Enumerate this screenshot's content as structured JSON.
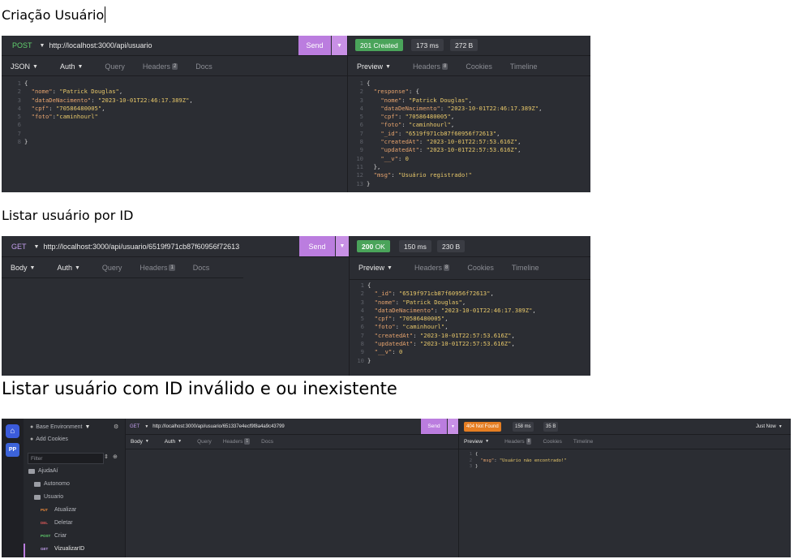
{
  "headings": {
    "create": "Criação Usuário",
    "list_by_id": "Listar usuário por ID",
    "list_invalid": "Listar usuário com ID inválido e ou inexistente"
  },
  "panel1": {
    "method": "POST",
    "url": "http://localhost:3000/api/usuario",
    "send": "Send",
    "status": "201 Created",
    "time": "173 ms",
    "size": "272 B",
    "request_tabs": [
      "JSON",
      "Auth",
      "Query",
      "Headers",
      "Docs"
    ],
    "headers_count": "2",
    "response_tabs": [
      "Preview",
      "Headers",
      "Cookies",
      "Timeline"
    ],
    "response_headers_count": "8",
    "request_body": [
      "{",
      "  \"nome\": \"Patrick Douglas\",",
      "  \"dataDeNacimento\": \"2023-10-01T22:46:17.389Z\",",
      "  \"cpf\": \"70586480005\",",
      "  \"foto\":\"caminhourl\"",
      "",
      "",
      "}"
    ],
    "response_body": [
      "{",
      "  \"response\": {",
      "    \"nome\": \"Patrick Douglas\",",
      "    \"dataDeNacimento\": \"2023-10-01T22:46:17.389Z\",",
      "    \"cpf\": \"70586480005\",",
      "    \"foto\": \"caminhourl\",",
      "    \"_id\": \"6519f971cb87f60956f72613\",",
      "    \"createdAt\": \"2023-10-01T22:57:53.616Z\",",
      "    \"updatedAt\": \"2023-10-01T22:57:53.616Z\",",
      "    \"__v\": 0",
      "  },",
      "  \"msg\": \"Usuário registrado!\"",
      "}"
    ]
  },
  "panel2": {
    "method": "GET",
    "url": "http://localhost:3000/api/usuario/6519f971cb87f60956f72613",
    "send": "Send",
    "status_code": "200",
    "status_text": "OK",
    "time": "150 ms",
    "size": "230 B",
    "request_tabs": [
      "Body",
      "Auth",
      "Query",
      "Headers",
      "Docs"
    ],
    "headers_count": "1",
    "response_tabs": [
      "Preview",
      "Headers",
      "Cookies",
      "Timeline"
    ],
    "response_headers_count": "8",
    "response_body": [
      "{",
      "  \"_id\": \"6519f971cb87f60956f72613\",",
      "  \"nome\": \"Patrick Douglas\",",
      "  \"dataDeNacimento\": \"2023-10-01T22:46:17.389Z\",",
      "  \"cpf\": \"70586480005\",",
      "  \"foto\": \"caminhourl\",",
      "  \"createdAt\": \"2023-10-01T22:57:53.616Z\",",
      "  \"updatedAt\": \"2023-10-01T22:57:53.616Z\",",
      "  \"__v\": 0",
      "}"
    ]
  },
  "panel3": {
    "environment": "Base Environment",
    "add_cookies": "Add Cookies",
    "filter_placeholder": "Filter",
    "workspace": "AjudaAí",
    "folders": [
      "Autonomo",
      "Usuario"
    ],
    "requests": [
      {
        "method": "PUT",
        "name": "Atualizar"
      },
      {
        "method": "DEL",
        "name": "Deletar"
      },
      {
        "method": "POST",
        "name": "Criar"
      },
      {
        "method": "GET",
        "name": "VizualizarID"
      }
    ],
    "pp": "PP",
    "method": "GET",
    "url": "http://localhost:3000/api/usuario/651337e4ecf9f8a4a9c43799",
    "send": "Send",
    "status": "404 Not Found",
    "time": "158 ms",
    "size": "35 B",
    "just_now": "Just Now",
    "request_tabs": [
      "Body",
      "Auth",
      "Query",
      "Headers",
      "Docs"
    ],
    "headers_count": "1",
    "response_tabs": [
      "Preview",
      "Headers",
      "Cookies",
      "Timeline"
    ],
    "response_headers_count": "8",
    "response_body": [
      "{",
      "  \"msg\": \"Usuário não encontrado!\"",
      "}"
    ]
  },
  "colors": {
    "panel_bg": "#2b2d33",
    "send": "#bb7ddf",
    "status_ok": "#4aa45a",
    "status_not_found": "#e67e22",
    "post": "#61d06e",
    "get": "#c39fee",
    "json_key": "#e7a46e",
    "json_string": "#e8c86a"
  }
}
